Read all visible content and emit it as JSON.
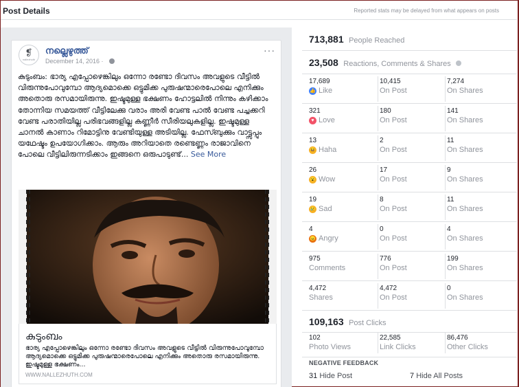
{
  "header": {
    "title": "Post Details",
    "note": "Reported stats may be delayed from what appears on posts"
  },
  "post": {
    "page_name": "നല്ലെഴുത്ത്",
    "avatar_glyph": "❡",
    "avatar_text": "nallezhuth",
    "date": "December 14, 2016 ·",
    "more": "···",
    "text": "കുടുംബം: ഭാര്യ എപ്പോഴെങ്കിലും ഒന്നോ രണ്ടോ ദിവസം അവളുടെ വീട്ടിൽ വിരുന്നുപോവുമ്പോ ആദ്യമൊക്കെ ഒട്ടുമിക്ക പുരുഷന്മാരെപോലെ എനിക്കും അതൊരു രസമായിരുന്നു. ഇഷ്ടമുള്ള ഭക്ഷണം ഹോട്ടലിൽ നിന്നും കഴിക്കാം തോന്നിയ സമയത്ത് വീട്ടിലേക്കു വരാം അരി വേണ്ട പാൽ വേണ്ട പച്ചക്കറി വേണ്ട പരാതിയില്ല പരിഭവങ്ങളില്ല കണ്ണീർ സീരിയലുകളില്ല. ഇഷ്ടമുള്ള ചാനൽ കാണാം റിമോട്ടിനു വേണ്ടിയുള്ള അടിയില്ല. ഫേസ്ബുക്കും വാട്ട്സപ്പും യഥേഷ്ടം ഉപയോഗിക്കാം. ആരും അറിയാതെ രണ്ടെണ്ണം രാജാവിനെ പോലെ വീട്ടിലിരുന്നടിക്കാം ഇങ്ങനെ ഒരുപാടുണ്ട്...",
    "see_more": "See More",
    "link_title": "കുടുംബം",
    "link_desc": "ഭാര്യ എപ്പോഴെങ്കിലും ഒന്നോ രണ്ടോ ദിവസം അവളുടെ വീട്ടിൽ വിരുന്നുപോവുമ്പോ ആദ്യമൊക്കെ ഒട്ടുമിക്ക പുരുഷന്മാരെപോലെ എനിക്കും അതൊരു രസമായിരുന്നു. ഇഷ്ടമുള്ള ഭക്ഷണം...",
    "link_domain": "WWW.NALLEZHUTH.COM"
  },
  "stats": {
    "reached": {
      "value": "713,881",
      "label": "People Reached"
    },
    "engagement": {
      "value": "23,508",
      "label": "Reactions, Comments & Shares"
    },
    "rows": [
      {
        "key": "like",
        "total": "17,689",
        "label": "Like",
        "icon": "like-icon",
        "color": "#4080ff",
        "glyph": "👍",
        "on_post": "10,415",
        "on_shares": "7,274"
      },
      {
        "key": "love",
        "total": "321",
        "label": "Love",
        "icon": "love-icon",
        "color": "#f25268",
        "glyph": "♥",
        "on_post": "180",
        "on_shares": "141"
      },
      {
        "key": "haha",
        "total": "13",
        "label": "Haha",
        "icon": "haha-icon",
        "color": "#f7b125",
        "glyph": "😆",
        "on_post": "2",
        "on_shares": "11"
      },
      {
        "key": "wow",
        "total": "26",
        "label": "Wow",
        "icon": "wow-icon",
        "color": "#f7b125",
        "glyph": "😮",
        "on_post": "17",
        "on_shares": "9"
      },
      {
        "key": "sad",
        "total": "19",
        "label": "Sad",
        "icon": "sad-icon",
        "color": "#f7b125",
        "glyph": "😢",
        "on_post": "8",
        "on_shares": "11"
      },
      {
        "key": "angry",
        "total": "4",
        "label": "Angry",
        "icon": "angry-icon",
        "color": "#e9710f",
        "glyph": "😠",
        "on_post": "0",
        "on_shares": "4"
      },
      {
        "key": "comments",
        "total": "975",
        "label": "Comments",
        "icon": "",
        "color": "",
        "glyph": "",
        "on_post": "776",
        "on_shares": "199"
      },
      {
        "key": "shares",
        "total": "4,472",
        "label": "Shares",
        "icon": "",
        "color": "",
        "glyph": "",
        "on_post": "4,472",
        "on_shares": "0"
      }
    ],
    "on_post_label": "On Post",
    "on_shares_label": "On Shares",
    "clicks": {
      "value": "109,163",
      "label": "Post Clicks"
    },
    "click_breakdown": [
      {
        "value": "102",
        "label": "Photo Views"
      },
      {
        "value": "22,585",
        "label": "Link Clicks"
      },
      {
        "value": "86,476",
        "label": "Other Clicks"
      }
    ],
    "negative": {
      "title": "NEGATIVE FEEDBACK",
      "hide_post": {
        "value": "31",
        "label": "Hide Post"
      },
      "hide_all": {
        "value": "7",
        "label": "Hide All Posts"
      }
    }
  }
}
